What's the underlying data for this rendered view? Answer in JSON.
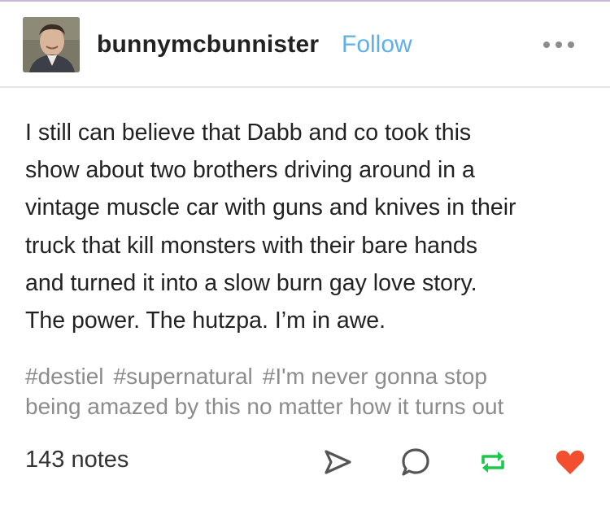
{
  "post": {
    "username": "bunnymcbunnister",
    "follow_label": "Follow",
    "more_icon": "more-horizontal-icon",
    "body_lines": [
      "I still can believe that Dabb and co took this",
      "show about two brothers driving around in a",
      "vintage muscle car with guns and knives in their",
      "truck that kill monsters with their bare hands",
      "and turned it into a slow burn gay love story.",
      "The power. The hutzpa. I’m in awe."
    ],
    "tags": {
      "line1": [
        "#destiel",
        "#supernatural",
        "#I'm never gonna stop"
      ],
      "line2": "being amazed by this no matter how it turns out"
    },
    "notes_label": "143 notes",
    "actions": {
      "share_icon": "send-icon",
      "reply_icon": "comment-icon",
      "reblog_icon": "reblog-icon",
      "like_icon": "heart-icon"
    }
  },
  "colors": {
    "follow": "#5fb0e8",
    "reblog": "#1bc94b",
    "like": "#f24e2f",
    "tags": "#8c8c8c"
  }
}
